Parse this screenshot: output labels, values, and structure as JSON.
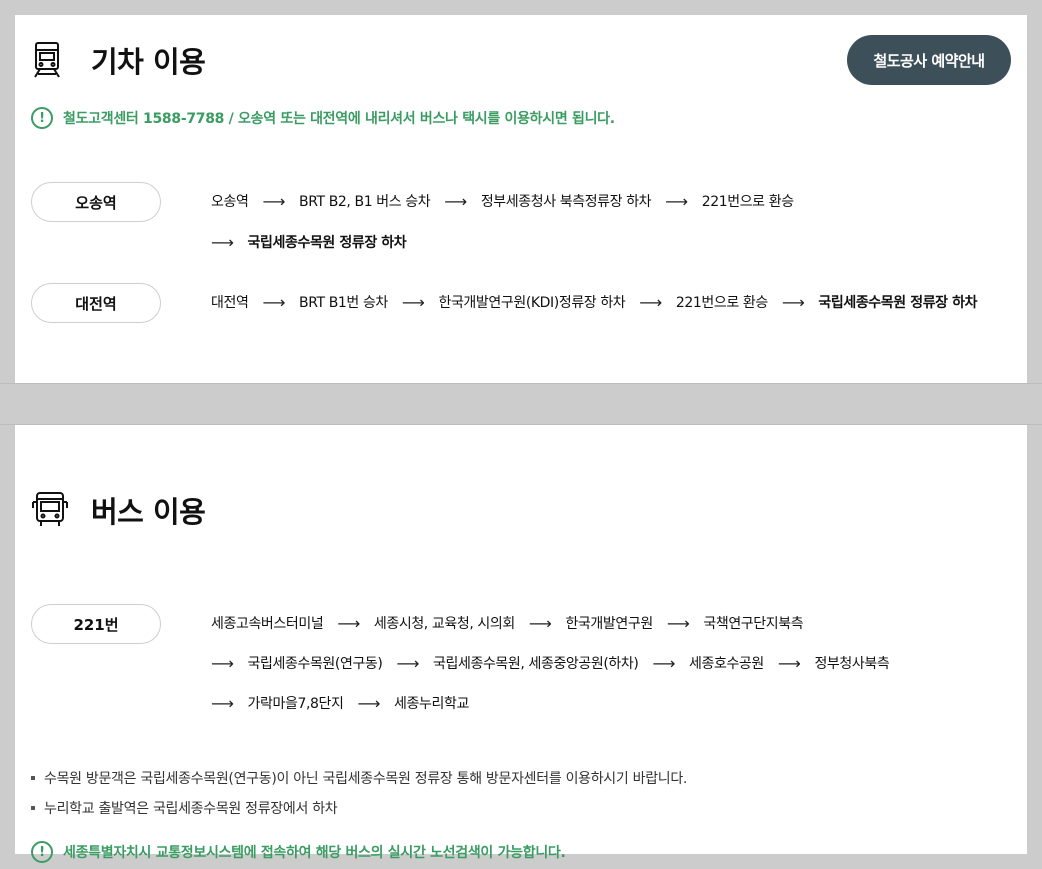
{
  "train": {
    "title": "기차 이용",
    "reserve_button": "철도공사 예약안내",
    "notice": "철도고객센터 1588-7788 / 오송역 또는 대전역에 내리셔서 버스나 택시를 이용하시면 됩니다.",
    "routes": [
      {
        "station": "오송역",
        "line1": [
          "오송역",
          "BRT B2, B1 버스 승차",
          "정부세종청사 북측정류장 하차",
          "221번으로 환승"
        ],
        "line2": [
          "국립세종수목원 정류장 하차"
        ]
      },
      {
        "station": "대전역",
        "line1": [
          "대전역",
          "BRT B1번 승차",
          "한국개발연구원(KDI)정류장 하차",
          "221번으로 환승",
          "국립세종수목원 정류장 하차"
        ]
      }
    ]
  },
  "bus": {
    "title": "버스 이용",
    "route_number": "221번",
    "line1": [
      "세종고속버스터미널",
      "세종시청, 교육청, 시의회",
      "한국개발연구원",
      "국책연구단지북측"
    ],
    "line2": [
      "국립세종수목원(연구동)",
      "국립세종수목원, 세종중앙공원(하차)",
      "세종호수공원",
      "정부청사북측"
    ],
    "line3": [
      "가락마을7,8단지",
      "세종누리학교"
    ],
    "bullets": [
      "수목원 방문객은 국립세종수목원(연구동)이 아닌 국립세종수목원 정류장 통해 방문자센터를 이용하시기 바랍니다.",
      "누리학교 출발역은 국립세종수목원 정류장에서 하차"
    ],
    "notice": "세종특별자치시 교통정보시스템에 접속하여 해당 버스의 실시간 노선검색이 가능합니다."
  },
  "icons": {
    "train": "train-icon",
    "bus": "bus-icon",
    "notice": "exclamation-circle-icon",
    "arrow": "long-arrow-right"
  },
  "colors": {
    "accent_green": "#3a9c63",
    "button_bg": "#3d5059",
    "page_bg": "#cccccc"
  }
}
